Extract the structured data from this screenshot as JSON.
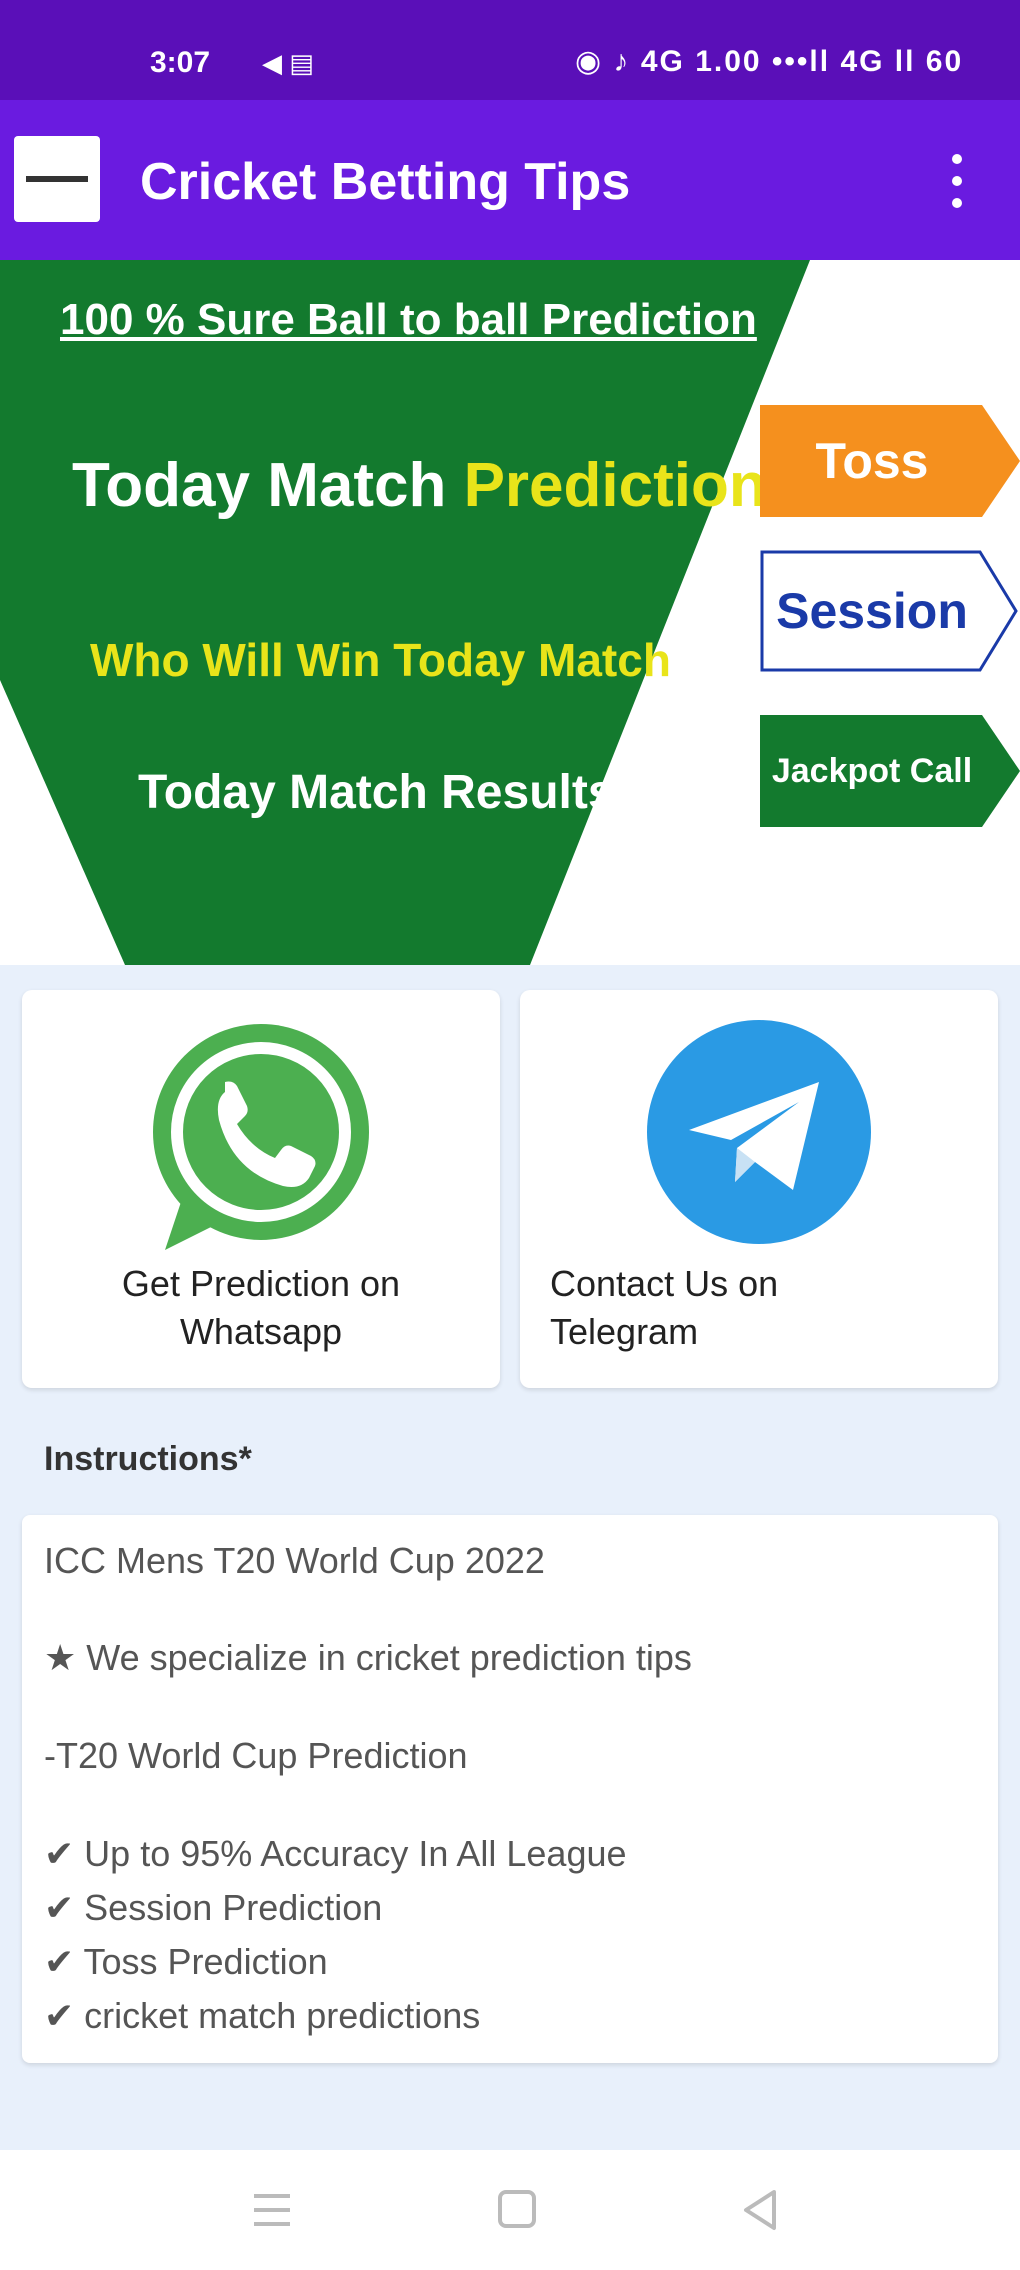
{
  "status_bar": {
    "time": "3:07",
    "left_icons": "◀ ▤",
    "right_status": "◉ ♪ 4G 1.00 •••ll 4G ll 60"
  },
  "app_bar": {
    "title": "Cricket Betting Tips",
    "logo": "app-logo",
    "menu_icon": "more-vert-icon"
  },
  "banner": {
    "line1": "100 % Sure Ball to ball Prediction",
    "line2_a": "Today Match ",
    "line2_b": "Prediction",
    "line3": "Who Will Win Today Match",
    "line4": "Today Match Results",
    "tags": {
      "toss": "Toss",
      "session": "Session",
      "jackpot": "Jackpot Call"
    },
    "colors": {
      "green": "#137a2e",
      "yellow": "#e9e41a",
      "orange": "#f5901e",
      "navy": "#1a3aa8"
    }
  },
  "contact": {
    "whatsapp": {
      "label": "Get Prediction on\nWhatsapp",
      "icon": "whatsapp-icon",
      "color": "#4caf50"
    },
    "telegram": {
      "label": "Contact Us on\nTelegram",
      "icon": "telegram-icon",
      "color": "#2a9ae4"
    }
  },
  "instructions": {
    "title": "Instructions*",
    "lines": [
      "ICC Mens T20 World Cup 2022",
      "★ We specialize in cricket prediction tips",
      "-T20 World Cup Prediction",
      "✔ Up to 95% Accuracy In All League",
      "✔ Session Prediction",
      "✔ Toss Prediction",
      "✔ cricket match predictions"
    ]
  },
  "nav": {
    "recents": "recents-icon",
    "home": "home-icon",
    "back": "back-icon"
  }
}
